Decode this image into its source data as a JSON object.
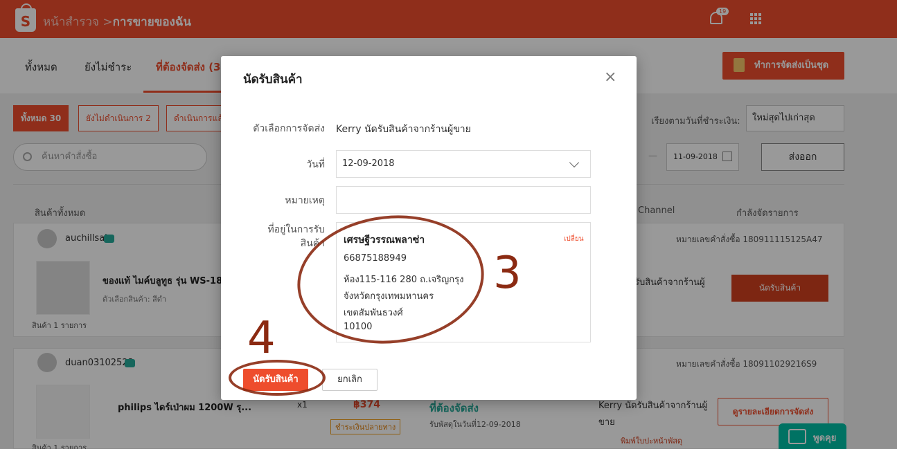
{
  "header": {
    "logo_letter": "S",
    "breadcrumb_parent": "หน้าสำรวจ",
    "breadcrumb_sep": ">",
    "breadcrumb_current": "การขายของฉัน",
    "notification_count": "19"
  },
  "tabs": [
    {
      "label": "ทั้งหมด"
    },
    {
      "label": "ยังไม่ชำระ"
    },
    {
      "label": "ที่ต้องจัดส่ง (3"
    }
  ],
  "bulk_ship_button": "ทำการจัดส่งเป็นชุด",
  "filters": [
    "ทั้งหมด 30",
    "ยังไม่ดำเนินการ 2",
    "ดำเนินการแล้"
  ],
  "sort": {
    "label": "เรียงตามวันที่ชำระเงิน:",
    "value": "ใหม่สุดไปเก่าสุด"
  },
  "search": {
    "placeholder": "ค้นหาคำสั่งซื้อ"
  },
  "date_to": "11-09-2018",
  "export_button": "ส่งออก",
  "table_headers": {
    "products": "สินค้าทั้งหมด",
    "channel": "Channel",
    "countdown": "กำลังจัดรายการ"
  },
  "orders": [
    {
      "username": "auchillsai",
      "order_no": "หมายเลขคำสั่งซื้อ 180911115125A47",
      "product": "ของแท้ ไมค์บลูทูธ รุ่น WS-18",
      "variant": "ตัวเลือกสินค้า: สีดำ",
      "count": "สินค้า 1 รายการ",
      "shipping": "รับสินค้าจากร้านผู้",
      "action": "นัดรับสินค้า"
    },
    {
      "username": "duan03102523",
      "order_no": "หมายเลขคำสั่งซื้อ 180911029216S9",
      "product": "philips ไดร์เป่าผม 1200W รุ...",
      "qty": "x1",
      "price": "฿374",
      "payment": "ชำระเงินปลายทาง",
      "status": "ที่ต้องจัดส่ง",
      "status_sub": "รับพัสดุในวันที่12-09-2018",
      "shipping_line1": "Kerry นัดรับสินค้าจากร้านผู้",
      "shipping_line2": "ขาย",
      "print_label": "พิมพ์ใบปะหน้าพัสดุ",
      "detail_button": "ดูรายละเอียดการจัดส่ง",
      "count": "สินค้า 1 รายการ"
    }
  ],
  "chat_widget": "พูดคุย",
  "modal": {
    "title": "นัดรับสินค้า",
    "close": "×",
    "shipping_option_label": "ตัวเลือกการจัดส่ง",
    "shipping_option_value": "Kerry นัดรับสินค้าจากร้านผู้ขาย",
    "date_label": "วันที่",
    "date_value": "12-09-2018",
    "note_label": "หมายเหตุ",
    "note_value": "",
    "address_label_1": "ที่อยู่ในการรับ",
    "address_label_2": "สินค้า",
    "address": {
      "name": "เศรษฐีวรรณพลาซ่า",
      "change": "เปลี่ยน",
      "phone": "66875188949",
      "line1": "ห้อง115-116  280 ถ.เจริญกรุง",
      "line2": "จังหวัดกรุงเทพมหานคร",
      "line3": "เขตสัมพันธวงศ์",
      "postcode": "10100"
    },
    "confirm_button": "นัดรับสินค้า",
    "cancel_button": "ยกเลิก"
  },
  "annotations": {
    "step3": "3",
    "step4": "4",
    "color": "#8b2a12"
  }
}
